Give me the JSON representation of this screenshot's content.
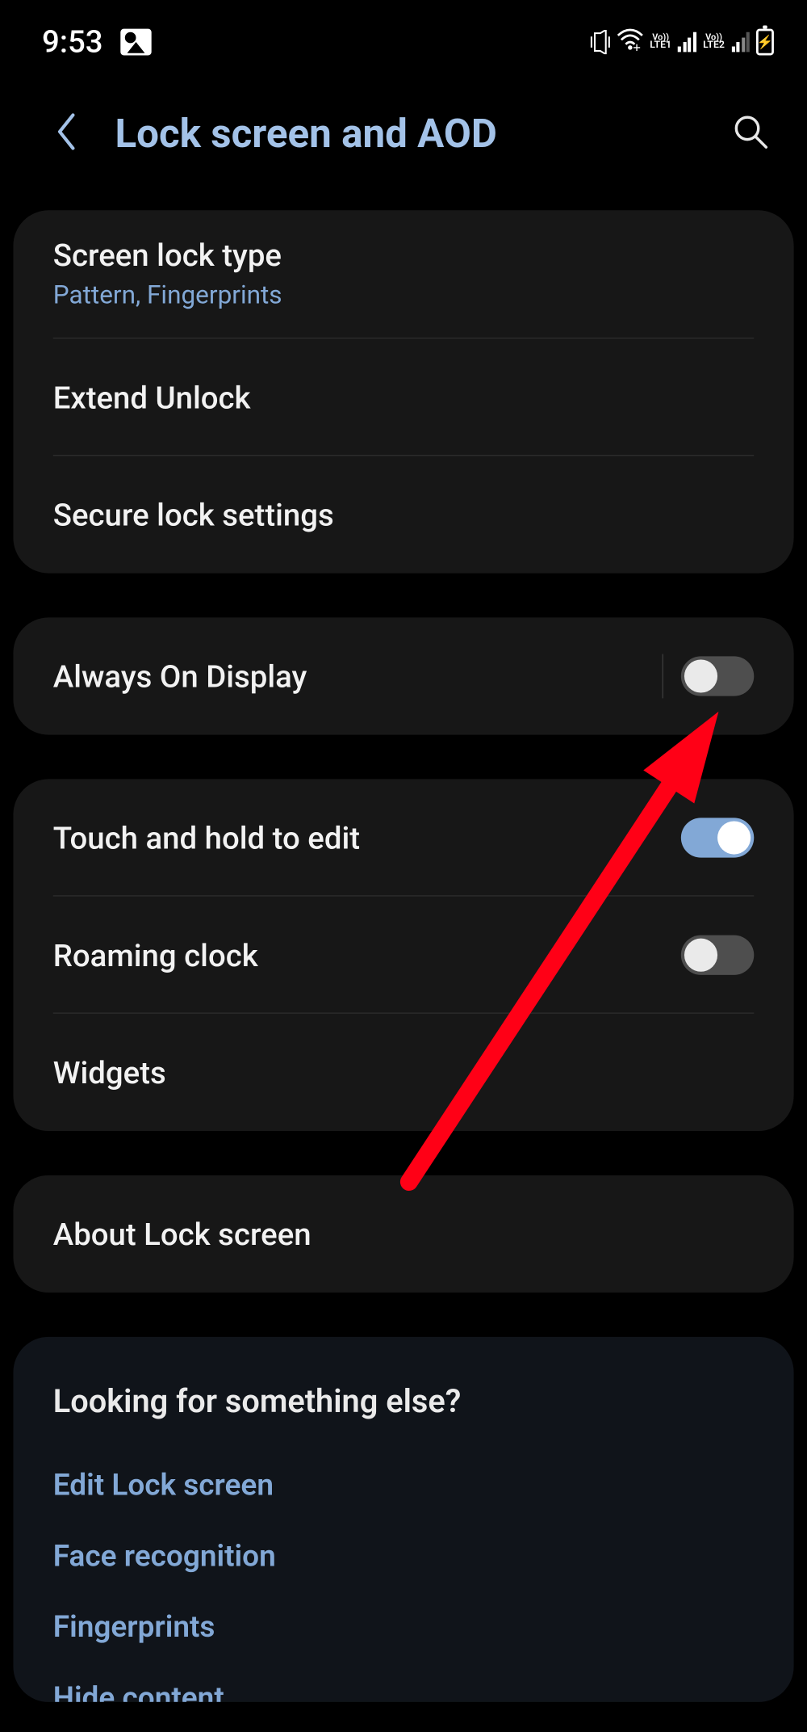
{
  "status_bar": {
    "time": "9:53",
    "sim1_label_top": "Vo))",
    "sim1_label_bottom": "LTE1",
    "sim2_label_top": "Vo))",
    "sim2_label_bottom": "LTE2"
  },
  "header": {
    "title": "Lock screen and AOD"
  },
  "sections": {
    "lock": {
      "screen_lock_type": {
        "label": "Screen lock type",
        "value": "Pattern, Fingerprints"
      },
      "extend_unlock": {
        "label": "Extend Unlock"
      },
      "secure_lock": {
        "label": "Secure lock settings"
      }
    },
    "aod": {
      "always_on_display": {
        "label": "Always On Display",
        "on": false
      }
    },
    "display": {
      "touch_hold_edit": {
        "label": "Touch and hold to edit",
        "on": true
      },
      "roaming_clock": {
        "label": "Roaming clock",
        "on": false
      },
      "widgets": {
        "label": "Widgets"
      }
    },
    "about": {
      "about_lock_screen": {
        "label": "About Lock screen"
      }
    }
  },
  "suggestions": {
    "title": "Looking for something else?",
    "links": [
      "Edit Lock screen",
      "Face recognition",
      "Fingerprints",
      "Hide content"
    ]
  },
  "colors": {
    "accent": "#82a8d6",
    "title_accent": "#a3c2e8",
    "card_bg": "#171717",
    "suggest_bg": "#10141a",
    "annotation_red": "#ff0016"
  }
}
